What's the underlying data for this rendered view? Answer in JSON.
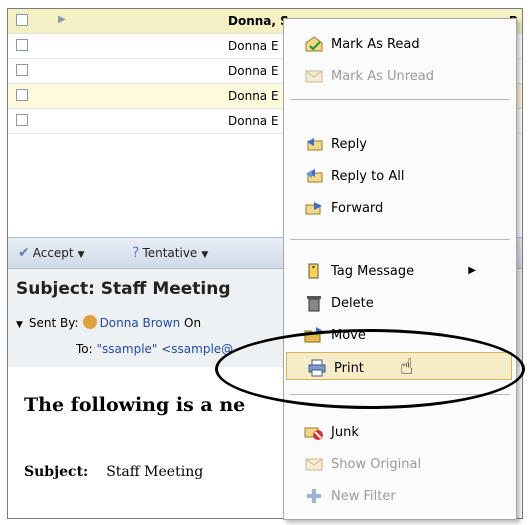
{
  "message_list": {
    "rows": [
      {
        "from": "Donna, S",
        "date": "B",
        "selected": true
      },
      {
        "from": "Donna E"
      },
      {
        "from": "Donna E"
      },
      {
        "from": "Donna E"
      },
      {
        "from": "Donna E"
      }
    ]
  },
  "toolbar": {
    "accept_label": "Accept",
    "tentative_label": "Tentative"
  },
  "header": {
    "subject": "Subject: Staff Meeting",
    "sent_by_label": "Sent By:",
    "sender": "Donna Brown",
    "on_label": "On",
    "to_label": "To:",
    "to_value": "\"ssample\" <ssample@"
  },
  "body": {
    "heading": "The following is a ne",
    "subject_label": "Subject:",
    "subject_value": "Staff Meeting"
  },
  "context_menu": {
    "items": [
      {
        "label": "Mark As Read",
        "icon": "envelope-open-check-icon",
        "enabled": true
      },
      {
        "label": "Mark As Unread",
        "icon": "envelope-icon",
        "enabled": false
      },
      {
        "label": "Reply",
        "icon": "reply-icon",
        "enabled": true
      },
      {
        "label": "Reply to All",
        "icon": "reply-all-icon",
        "enabled": true
      },
      {
        "label": "Forward",
        "icon": "forward-icon",
        "enabled": true
      },
      {
        "label": "Tag Message",
        "icon": "tag-icon",
        "enabled": true,
        "submenu": true
      },
      {
        "label": "Delete",
        "icon": "trash-icon",
        "enabled": true
      },
      {
        "label": "Move",
        "icon": "move-folder-icon",
        "enabled": true
      },
      {
        "label": "Print",
        "icon": "printer-icon",
        "enabled": true,
        "hovered": true
      },
      {
        "label": "Junk",
        "icon": "junk-icon",
        "enabled": true
      },
      {
        "label": "Show Original",
        "icon": "envelope-icon",
        "enabled": false
      },
      {
        "label": "New Filter",
        "icon": "plus-icon",
        "enabled": false
      }
    ]
  },
  "colors": {
    "selected_row": "#f5f0c4",
    "hover_item": "#f6ecc6",
    "link": "#1f4aa8"
  }
}
